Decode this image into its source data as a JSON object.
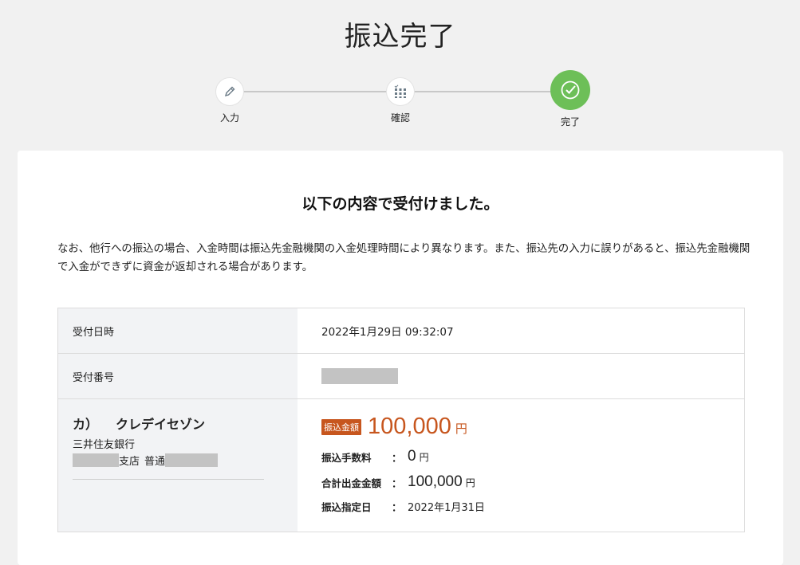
{
  "page": {
    "title": "振込完了"
  },
  "stepper": {
    "steps": [
      {
        "label": "入力",
        "icon": "pencil-icon",
        "state": "done"
      },
      {
        "label": "確認",
        "icon": "grid-check-icon",
        "state": "done"
      },
      {
        "label": "完了",
        "icon": "check-circle-icon",
        "state": "active"
      }
    ],
    "active_color": "#6dbf58"
  },
  "card": {
    "heading": "以下の内容で受付けました。",
    "notice": "なお、他行への振込の場合、入金時間は振込先金融機関の入金処理時間により異なります。また、振込先の入力に誤りがあると、振込先金融機関で入金ができずに資金が返却される場合があります。",
    "rows": {
      "received_at": {
        "label": "受付日時",
        "value": "2022年1月29日 09:32:07"
      },
      "reception_number": {
        "label": "受付番号"
      }
    },
    "payee": {
      "name_prefix": "カ）",
      "name": "クレデイセゾン",
      "bank": "三井住友銀行",
      "branch_suffix": "支店",
      "account_type": "普通"
    },
    "transfer": {
      "badge": "振込金額",
      "amount": "100,000",
      "amount_unit": "円",
      "fee_label": "振込手数料",
      "fee": "0",
      "fee_unit": "円",
      "total_label": "合計出金金額",
      "total": "100,000",
      "total_unit": "円",
      "date_label": "振込指定日",
      "date": "2022年1月31日",
      "colon": "："
    },
    "accent_color": "#c7561e"
  }
}
